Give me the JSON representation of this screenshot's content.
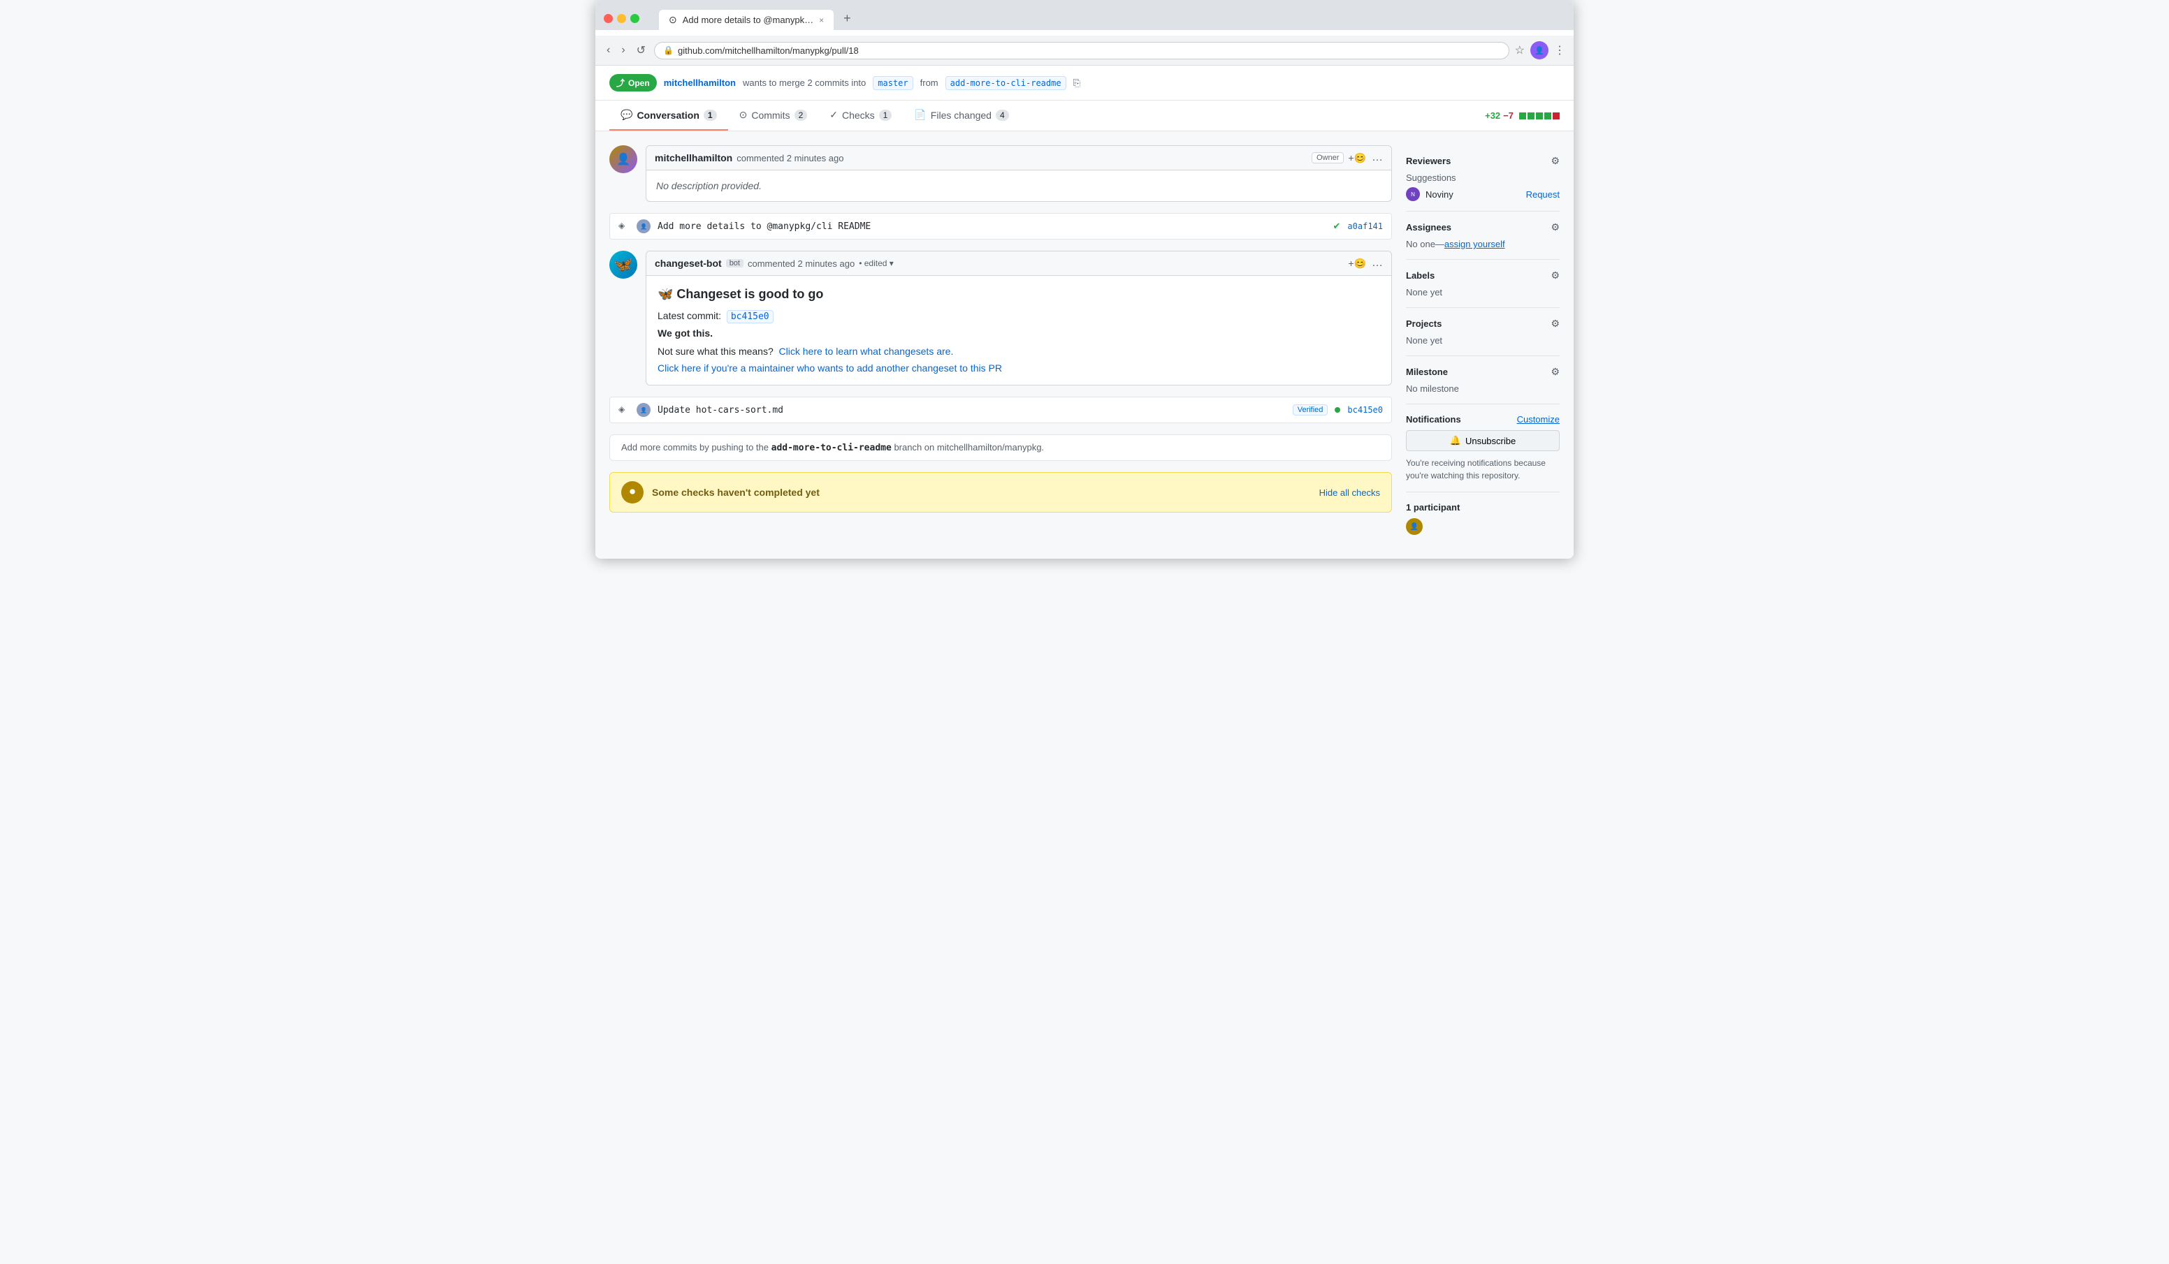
{
  "browser": {
    "tab_title": "Add more details to @manypk…",
    "tab_close": "×",
    "tab_new": "+",
    "url": "github.com/mitchellhamilton/manypkg/pull/18",
    "back": "‹",
    "forward": "›",
    "reload": "↺"
  },
  "pr": {
    "status": "Open",
    "status_icon": "⤴",
    "author": "mitchellhamilton",
    "action": "wants to merge 2 commits into",
    "base_branch": "master",
    "from_text": "from",
    "head_branch": "add-more-to-cli-readme",
    "tabs": [
      {
        "id": "conversation",
        "label": "Conversation",
        "icon": "💬",
        "count": "1",
        "active": true
      },
      {
        "id": "commits",
        "label": "Commits",
        "icon": "⊙",
        "count": "2",
        "active": false
      },
      {
        "id": "checks",
        "label": "Checks",
        "icon": "✓",
        "count": "1",
        "active": false
      },
      {
        "id": "files-changed",
        "label": "Files changed",
        "icon": "📄",
        "count": "4",
        "active": false
      }
    ],
    "diff_additions": "+32",
    "diff_deletions": "−7",
    "diff_segments": [
      "green",
      "green",
      "green",
      "green",
      "red"
    ],
    "comments": [
      {
        "id": "main-comment",
        "author": "mitchellhamilton",
        "time": "commented 2 minutes ago",
        "badge": "Owner",
        "content": "No description provided."
      }
    ],
    "commits": [
      {
        "id": "commit-1",
        "message": "Add more details to @manypkg/cli README",
        "sha": "a0af141",
        "verified": false,
        "check_icon": "✓"
      }
    ],
    "bot_comment": {
      "author": "changeset-bot",
      "badge": "bot",
      "time": "commented 2 minutes ago",
      "edited": "• edited ▾",
      "title": "🦋 Changeset is good to go",
      "latest_commit_label": "Latest commit:",
      "latest_commit_sha": "bc415e0",
      "got_it": "We got this.",
      "not_sure_text": "Not sure what this means?",
      "learn_link": "Click here to learn what changesets are.",
      "maintainer_link": "Click here if you're a maintainer who wants to add another changeset to this PR"
    },
    "commit2": {
      "message": "Update hot-cars-sort.md",
      "sha": "bc415e0",
      "verified": true,
      "verified_label": "Verified"
    },
    "push_notice": "Add more commits by pushing to the",
    "push_branch": "add-more-to-cli-readme",
    "push_suffix": "branch on mitchellhamilton/manypkg.",
    "checks_banner": {
      "text": "Some checks haven't completed yet",
      "hide_label": "Hide all checks"
    }
  },
  "sidebar": {
    "reviewers": {
      "title": "Reviewers",
      "suggestions_label": "Suggestions",
      "reviewer_name": "Noviny",
      "request_label": "Request"
    },
    "assignees": {
      "title": "Assignees",
      "value": "No one—assign yourself",
      "assign_label": "assign yourself"
    },
    "labels": {
      "title": "Labels",
      "value": "None yet"
    },
    "projects": {
      "title": "Projects",
      "value": "None yet"
    },
    "milestone": {
      "title": "Milestone",
      "value": "No milestone"
    },
    "notifications": {
      "title": "Notifications",
      "customize_label": "Customize",
      "unsubscribe_label": "Unsubscribe",
      "unsubscribe_icon": "🔔",
      "notice": "You're receiving notifications because you're watching this repository."
    },
    "participants": {
      "title": "1 participant"
    }
  }
}
